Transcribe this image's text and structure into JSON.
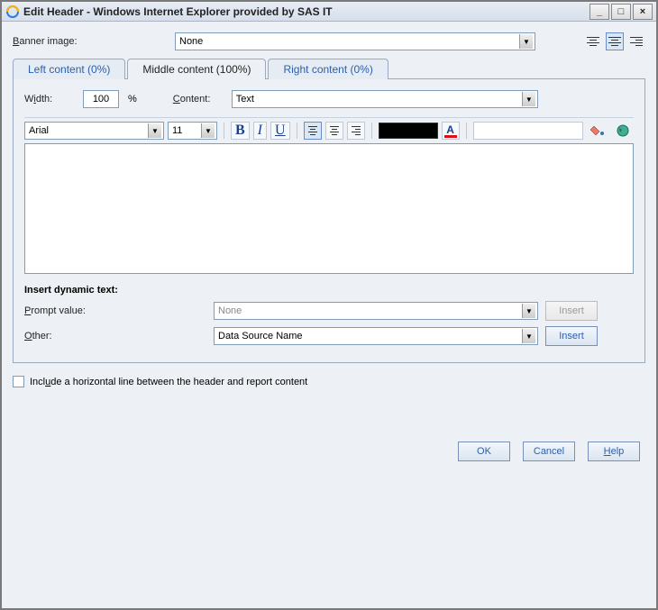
{
  "window": {
    "title": "Edit Header - Windows Internet Explorer provided by SAS IT"
  },
  "banner": {
    "label": "Banner image:",
    "value": "None"
  },
  "tabs": {
    "left": "Left content (0%)",
    "middle": "Middle content (100%)",
    "right": "Right content (0%)"
  },
  "form": {
    "width_label": "Width:",
    "width_value": "100",
    "width_unit": "%",
    "content_label": "Content:",
    "content_value": "Text"
  },
  "toolbar": {
    "font": "Arial",
    "size": "11"
  },
  "dynamic": {
    "section_label": "Insert dynamic text:",
    "prompt_label": "Prompt value:",
    "prompt_value": "None",
    "other_label": "Other:",
    "other_value": "Data Source Name",
    "insert_btn": "Insert"
  },
  "checkbox": {
    "label_before": "Incl",
    "label_u": "u",
    "label_after": "de a horizontal line between the header and report content"
  },
  "buttons": {
    "ok": "OK",
    "cancel": "Cancel",
    "help": "Help"
  }
}
